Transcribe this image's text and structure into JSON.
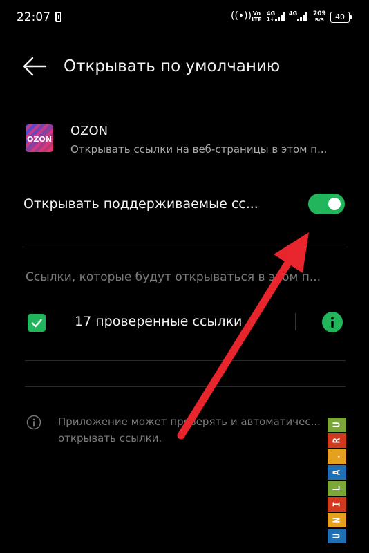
{
  "status_bar": {
    "time": "22:07",
    "lte_top": "Vo",
    "lte_bottom": "LTE",
    "net1_label": "4G",
    "net1_sub": "1↓",
    "net2_label": "4G",
    "speed_value": "209",
    "speed_unit": "B/S",
    "battery": "40",
    "icons": [
      "phone-icon",
      "hotspot-icon",
      "signal-icon",
      "battery-icon"
    ]
  },
  "header": {
    "back_icon": "arrow-left-icon",
    "title": "Открывать по умолчанию"
  },
  "app": {
    "icon": "ozon-app-icon",
    "icon_text": "OZON",
    "name": "OZON",
    "description": "Открывать ссылки на веб-страницы в этом п..."
  },
  "open_supported": {
    "label": "Открывать поддерживаемые сс...",
    "enabled": true
  },
  "links_section": {
    "header": "Ссылки, которые будут открываться в этом п...",
    "checked": true,
    "verified_label": "17 проверенные ссылки",
    "info_icon": "info-icon"
  },
  "note": {
    "icon": "info-outline-icon",
    "line1": "Приложение может проверять и автоматичес...",
    "line2": "открывать ссылки."
  },
  "watermark": {
    "letters": [
      "U",
      "N",
      "I",
      "L",
      "A",
      ".",
      "R",
      "U"
    ],
    "colors": [
      "#1e6fb4",
      "#e6a020",
      "#d23a1e",
      "#7aa63a",
      "#1e6fb4",
      "#e6a020",
      "#d23a1e",
      "#7aa63a"
    ]
  },
  "annotation": {
    "arrow_color": "#e8242c"
  },
  "colors": {
    "accent": "#21b55c",
    "background": "#000000"
  }
}
